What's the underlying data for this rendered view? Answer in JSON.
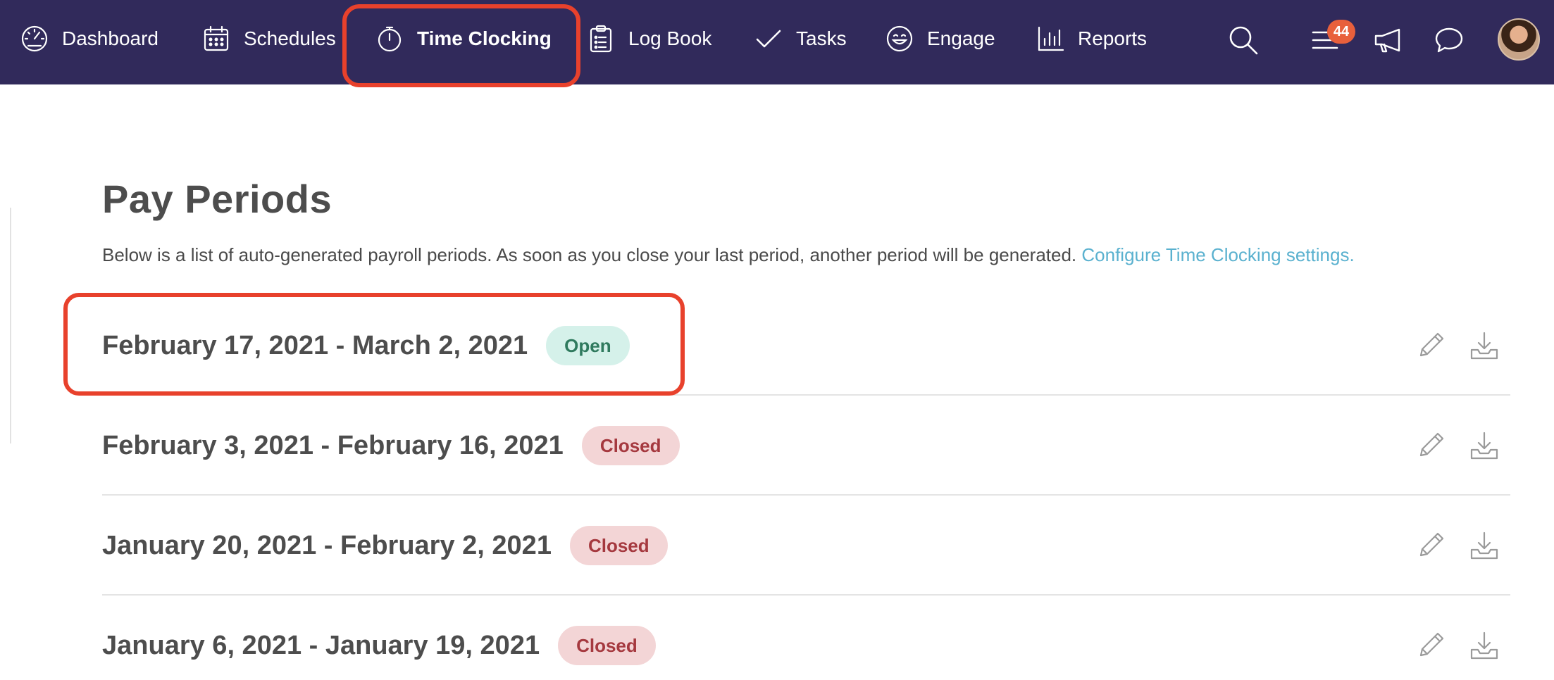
{
  "nav": {
    "items": [
      {
        "label": "Dashboard",
        "icon": "gauge-icon"
      },
      {
        "label": "Schedules",
        "icon": "calendar-icon"
      },
      {
        "label": "Time Clocking",
        "icon": "stopwatch-icon",
        "active": true
      },
      {
        "label": "Log Book",
        "icon": "clipboard-icon"
      },
      {
        "label": "Tasks",
        "icon": "checkmark-icon"
      },
      {
        "label": "Engage",
        "icon": "smiley-icon"
      },
      {
        "label": "Reports",
        "icon": "bar-chart-icon"
      }
    ],
    "notification_count": "44",
    "colors": {
      "bar": "#312a5b",
      "highlight": "#e8412c",
      "badge": "#e8603c"
    }
  },
  "page": {
    "title": "Pay Periods",
    "intro": "Below is a list of auto-generated payroll periods. As soon as you close your last period, another period will be generated.",
    "settings_link": "Configure Time Clocking settings."
  },
  "periods": [
    {
      "dates": "February 17, 2021 - March 2, 2021",
      "status": "Open"
    },
    {
      "dates": "February 3, 2021 - February 16, 2021",
      "status": "Closed"
    },
    {
      "dates": "January 20, 2021 - February 2, 2021",
      "status": "Closed"
    },
    {
      "dates": "January 6, 2021 - January 19, 2021",
      "status": "Closed"
    }
  ]
}
